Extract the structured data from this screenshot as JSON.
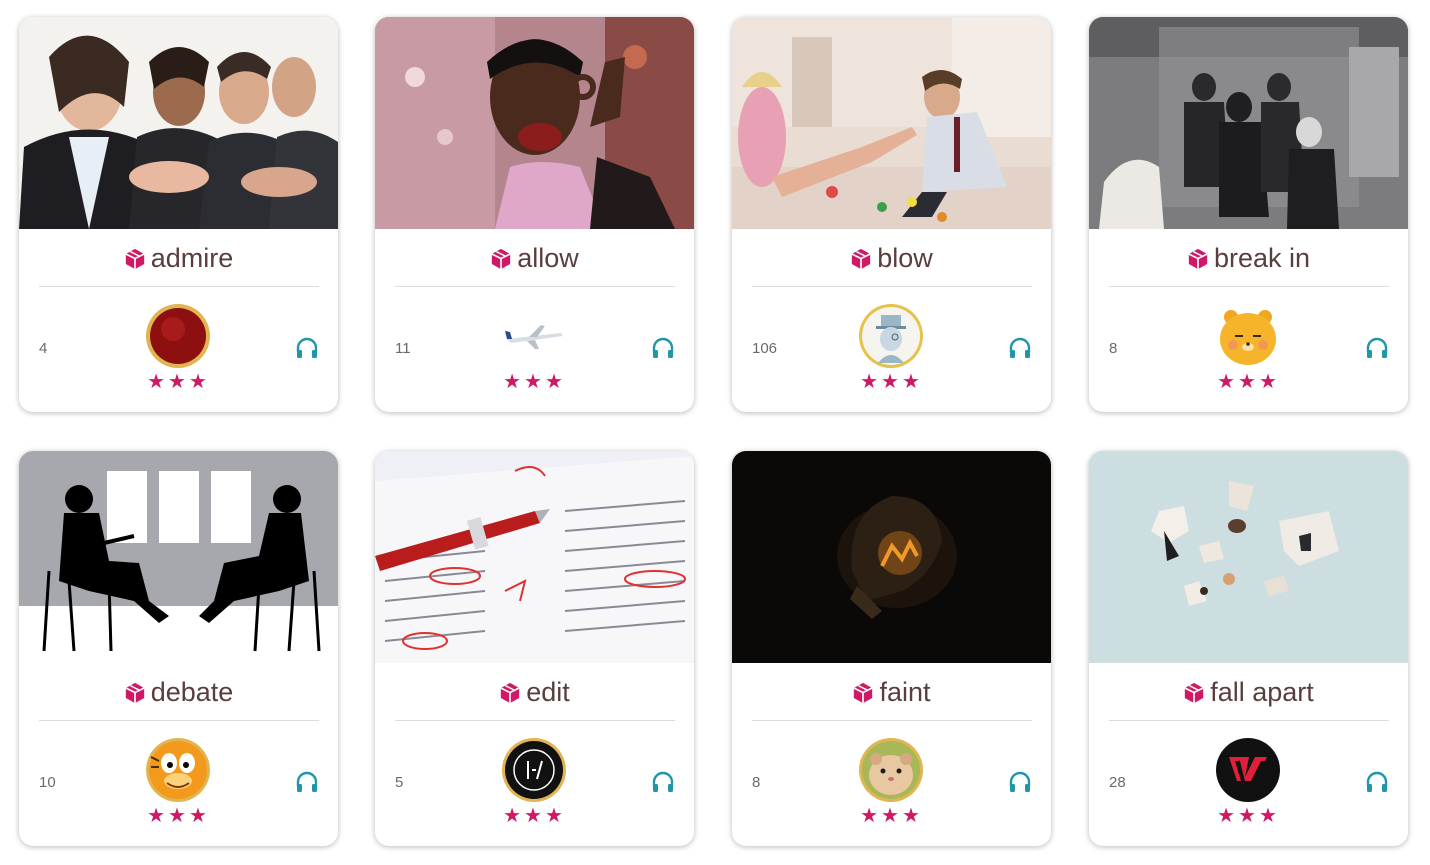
{
  "accent_color": "#d01966",
  "audio_color": "#2196a8",
  "cube_icon": "cube-icon",
  "audio_icon": "headphones-icon",
  "cards": [
    {
      "word": "admire",
      "count": "4",
      "stars": "★★★",
      "photo": "people-applauding",
      "avatar": "red-badge"
    },
    {
      "word": "allow",
      "count": "11",
      "stars": "★★★",
      "photo": "man-ok-gesture",
      "avatar": "airplane"
    },
    {
      "word": "blow",
      "count": "106",
      "stars": "★★★",
      "photo": "couple-on-floor",
      "avatar": "monocle-man"
    },
    {
      "word": "break in",
      "count": "8",
      "stars": "★★★",
      "photo": "masked-men-store",
      "avatar": "yellow-lion"
    },
    {
      "word": "debate",
      "count": "10",
      "stars": "★★★",
      "photo": "silhouette-discussion",
      "avatar": "garfield"
    },
    {
      "word": "edit",
      "count": "5",
      "stars": "★★★",
      "photo": "red-pen-proofreading",
      "avatar": "band-logo"
    },
    {
      "word": "faint",
      "count": "8",
      "stars": "★★★",
      "photo": "dim-light-bulb",
      "avatar": "hamster"
    },
    {
      "word": "fall apart",
      "count": "28",
      "stars": "★★★",
      "photo": "broken-figurine",
      "avatar": "twice-logo"
    }
  ]
}
